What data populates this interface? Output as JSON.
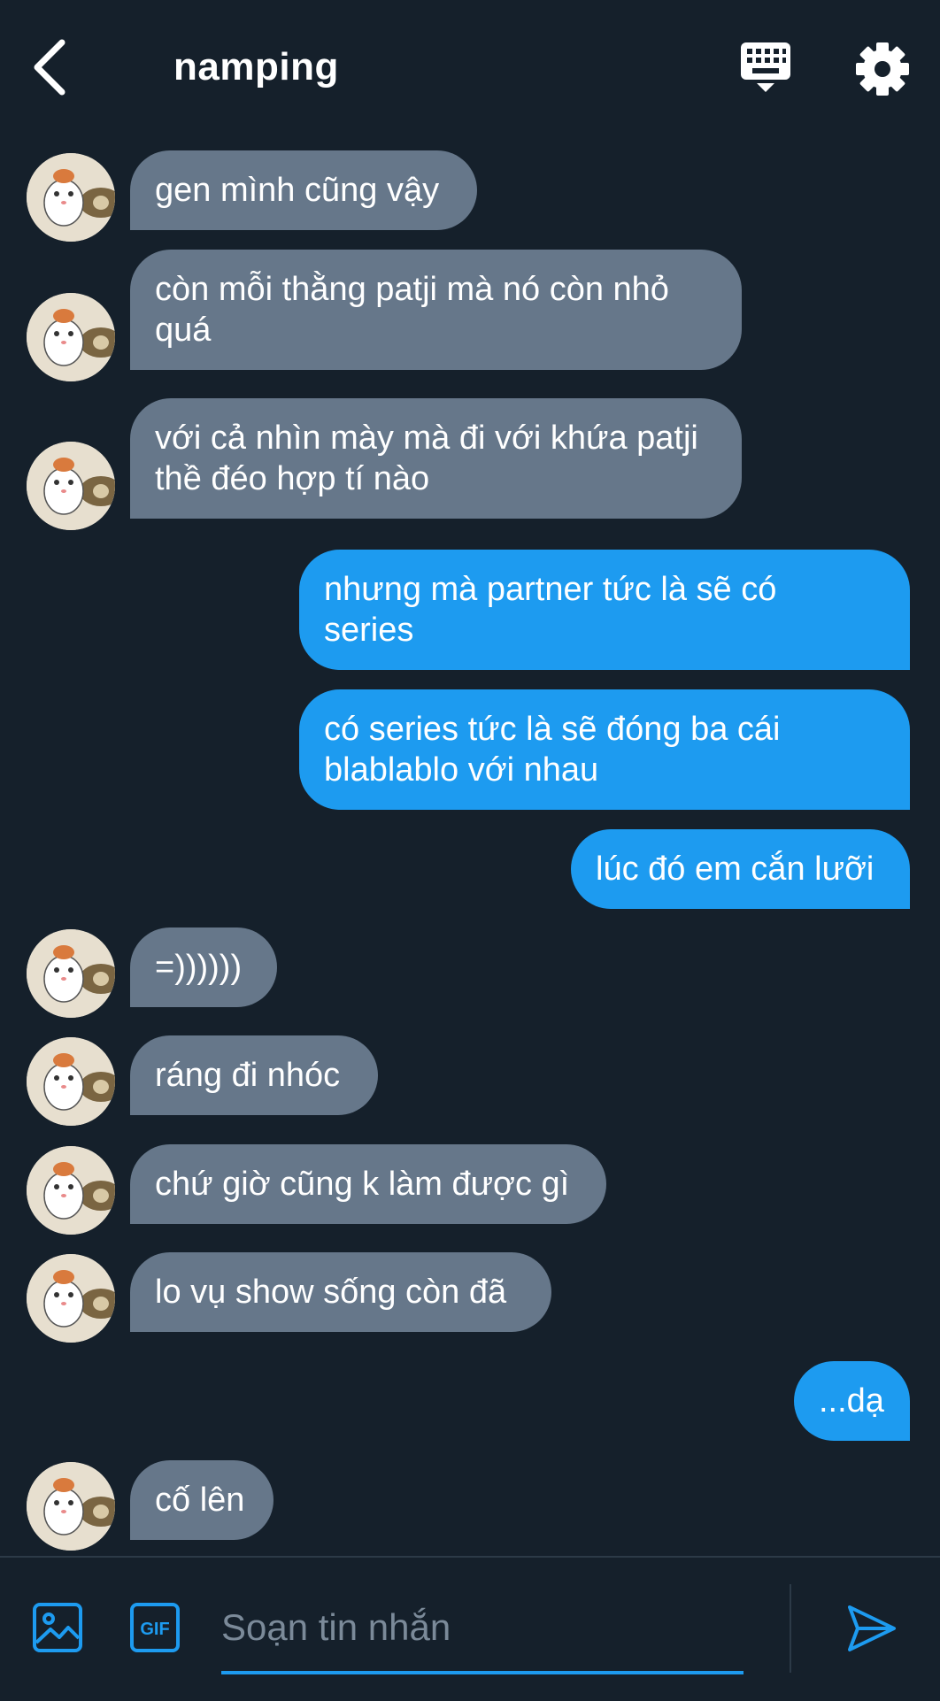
{
  "header": {
    "title": "namping",
    "icons": [
      "back-arrow-icon",
      "keyboard-icon",
      "gear-icon"
    ]
  },
  "messages": [
    {
      "dir": "in",
      "text": "gen mình cũng vậy"
    },
    {
      "dir": "in",
      "text": "còn mỗi thằng patji mà nó còn nhỏ\nquá"
    },
    {
      "dir": "in",
      "text": "với cả nhìn mày mà đi với khứa patji\nthề đéo hợp tí nào"
    },
    {
      "dir": "out",
      "text": "nhưng mà partner tức là sẽ có\nseries"
    },
    {
      "dir": "out",
      "text": "có series tức là sẽ đóng ba cái\nblablablo với nhau"
    },
    {
      "dir": "out",
      "text": "lúc đó em cắn lưỡi"
    },
    {
      "dir": "in",
      "text": "=))))))"
    },
    {
      "dir": "in",
      "text": "ráng đi nhóc"
    },
    {
      "dir": "in",
      "text": "chứ giờ cũng k làm được gì"
    },
    {
      "dir": "in",
      "text": "lo vụ show sống còn đã"
    },
    {
      "dir": "out",
      "text": "...dạ"
    },
    {
      "dir": "in",
      "text": "cố lên"
    }
  ],
  "composer": {
    "placeholder": "Soạn tin nhắn",
    "gif_label": "GIF",
    "icons": [
      "image-icon",
      "gif-icon",
      "send-icon"
    ]
  },
  "colors": {
    "background": "#15202b",
    "incoming_bubble": "#66778a",
    "outgoing_bubble": "#1d9bf0",
    "accent": "#1d9bf0"
  }
}
